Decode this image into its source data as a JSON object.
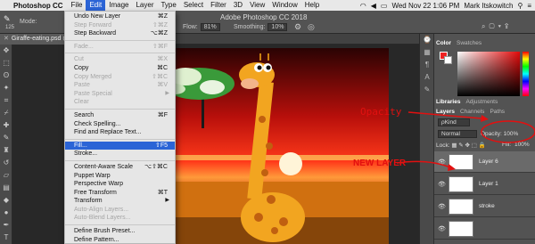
{
  "menubar": {
    "app": "Photoshop CC",
    "menus": [
      "File",
      "Edit",
      "Image",
      "Layer",
      "Type",
      "Select",
      "Filter",
      "3D",
      "View",
      "Window",
      "Help"
    ],
    "active_menu": "Edit",
    "datetime": "Wed Nov 22 1:06 PM",
    "user": "Mark Itskowitch"
  },
  "options": {
    "window_title": "Adobe Photoshop CC 2018",
    "brush_size": "125",
    "mode_label": "Mode:",
    "flow_label": "Flow:",
    "flow_value": "81%",
    "smoothing_label": "Smoothing:",
    "smoothing_value": "10%"
  },
  "document_tab": {
    "title": "Giraffe-eating.psd @ 19"
  },
  "edit_menu": {
    "items": [
      {
        "label": "Undo New Layer",
        "shortcut": "⌘Z",
        "enabled": true
      },
      {
        "label": "Step Forward",
        "shortcut": "⇧⌘Z",
        "enabled": false
      },
      {
        "label": "Step Backward",
        "shortcut": "⌥⌘Z",
        "enabled": true
      },
      {
        "sep": true
      },
      {
        "label": "Fade...",
        "shortcut": "⇧⌘F",
        "enabled": false
      },
      {
        "sep": true
      },
      {
        "label": "Cut",
        "shortcut": "⌘X",
        "enabled": false
      },
      {
        "label": "Copy",
        "shortcut": "⌘C",
        "enabled": true
      },
      {
        "label": "Copy Merged",
        "shortcut": "⇧⌘C",
        "enabled": false
      },
      {
        "label": "Paste",
        "shortcut": "⌘V",
        "enabled": false
      },
      {
        "label": "Paste Special",
        "shortcut": "",
        "enabled": false,
        "submenu": true
      },
      {
        "label": "Clear",
        "shortcut": "",
        "enabled": false
      },
      {
        "sep": true
      },
      {
        "label": "Search",
        "shortcut": "⌘F",
        "enabled": true
      },
      {
        "label": "Check Spelling...",
        "shortcut": "",
        "enabled": true
      },
      {
        "label": "Find and Replace Text...",
        "shortcut": "",
        "enabled": true
      },
      {
        "sep": true
      },
      {
        "label": "Fill...",
        "shortcut": "⇧F5",
        "enabled": true,
        "highlighted": true
      },
      {
        "label": "Stroke...",
        "shortcut": "",
        "enabled": true
      },
      {
        "sep": true
      },
      {
        "label": "Content-Aware Scale",
        "shortcut": "⌥⇧⌘C",
        "enabled": true
      },
      {
        "label": "Puppet Warp",
        "shortcut": "",
        "enabled": true
      },
      {
        "label": "Perspective Warp",
        "shortcut": "",
        "enabled": true
      },
      {
        "label": "Free Transform",
        "shortcut": "⌘T",
        "enabled": true
      },
      {
        "label": "Transform",
        "shortcut": "",
        "enabled": true,
        "submenu": true
      },
      {
        "label": "Auto-Align Layers...",
        "shortcut": "",
        "enabled": false
      },
      {
        "label": "Auto-Blend Layers...",
        "shortcut": "",
        "enabled": false
      },
      {
        "sep": true
      },
      {
        "label": "Define Brush Preset...",
        "shortcut": "",
        "enabled": true
      },
      {
        "label": "Define Pattern...",
        "shortcut": "",
        "enabled": true
      }
    ]
  },
  "panels": {
    "color_tabs": [
      "Color",
      "Swatches"
    ],
    "lib_tabs": [
      "Libraries",
      "Adjustments"
    ],
    "layer_tabs": [
      "Layers",
      "Channels",
      "Paths"
    ],
    "kind_label": "ρKind",
    "blend_mode": "Normal",
    "opacity_label": "Opacity:",
    "opacity_value": "100%",
    "lock_label": "Lock:",
    "fill_label": "Fill:",
    "fill_value": "100%",
    "layers": [
      {
        "name": "Layer 6",
        "selected": true
      },
      {
        "name": "Layer 1",
        "selected": false
      },
      {
        "name": "stroke",
        "selected": false
      },
      {
        "name": "",
        "selected": false
      }
    ]
  },
  "annotations": {
    "opacity": "Opacity",
    "new_layer": "NEW LAYER"
  },
  "colors": {
    "accent": "#2b64d6",
    "annotation": "#e21010",
    "foreground_swatch": "#e22222"
  }
}
